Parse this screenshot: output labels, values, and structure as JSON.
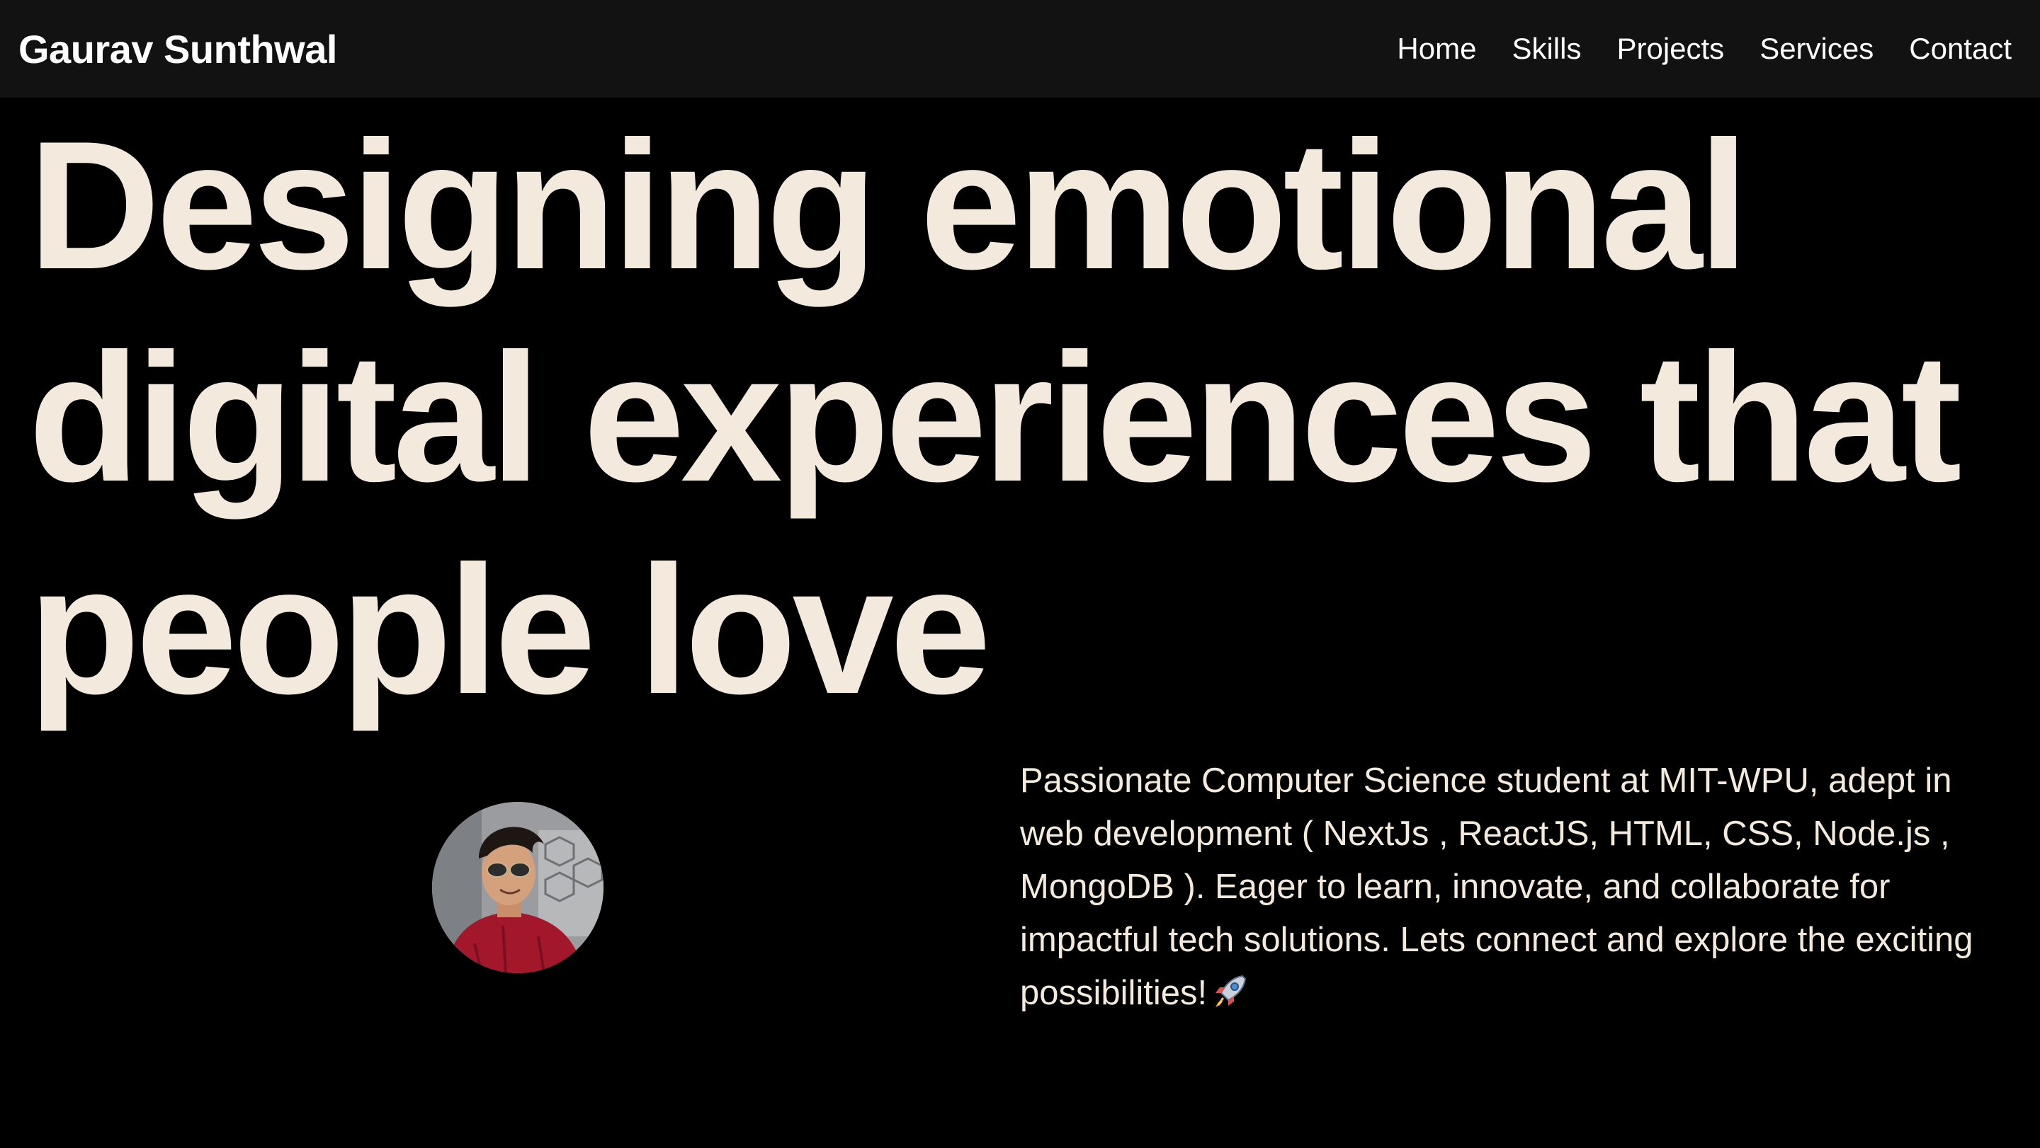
{
  "header": {
    "brand": "Gaurav Sunthwal",
    "nav": [
      {
        "label": "Home"
      },
      {
        "label": "Skills"
      },
      {
        "label": "Projects"
      },
      {
        "label": "Services"
      },
      {
        "label": "Contact"
      }
    ]
  },
  "hero": {
    "title": "Designing emotional digital experiences that people love"
  },
  "about": {
    "description": "Passionate Computer Science student at MIT-WPU, adept in web development ( NextJs , ReactJS, HTML, CSS, Node.js , MongoDB ). Eager to learn, innovate, and collaborate for impactful tech solutions. Lets connect and explore the exciting possibilities!",
    "emoji_icon": "rocket-icon"
  },
  "colors": {
    "background": "#000000",
    "navbar": "#121212",
    "hero_text": "#f3e9dc",
    "nav_text": "#ffffff"
  }
}
